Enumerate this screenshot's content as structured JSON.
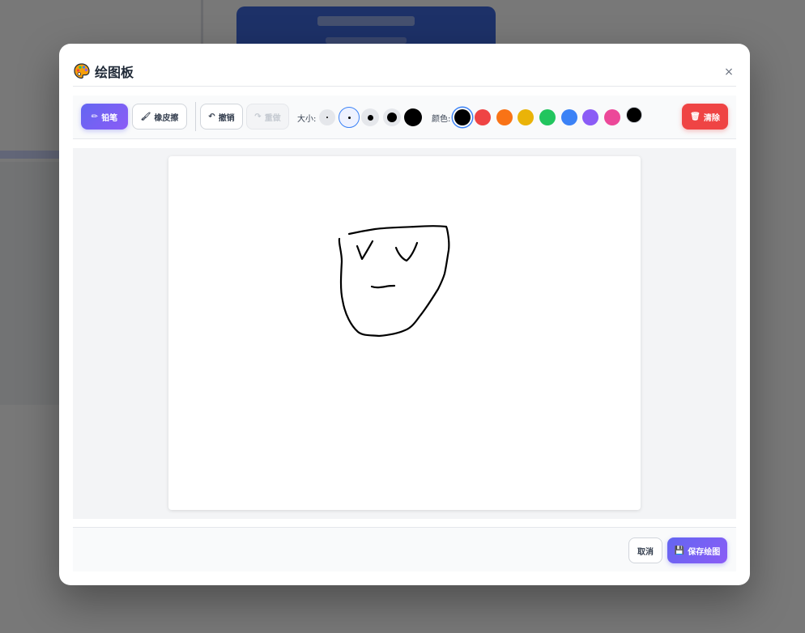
{
  "modal": {
    "title": "绘图板",
    "title_icon": "palette-icon",
    "close_label": "×"
  },
  "toolbar": {
    "pencil": {
      "icon": "✏",
      "icon_name": "pencil-icon",
      "label": "铅笔",
      "active": true
    },
    "eraser": {
      "icon": "🖌",
      "icon_name": "eraser-icon",
      "label": "橡皮擦"
    },
    "undo": {
      "icon": "↶",
      "icon_name": "undo-icon",
      "label": "撤销"
    },
    "redo": {
      "icon": "↷",
      "icon_name": "redo-icon",
      "label": "重做",
      "disabled": true
    },
    "size_label": "大小:",
    "sizes": [
      {
        "value": 1,
        "selected": false
      },
      {
        "value": 2,
        "selected": true
      },
      {
        "value": 4,
        "selected": false
      },
      {
        "value": 6,
        "selected": false
      },
      {
        "value": 10,
        "selected": false
      }
    ],
    "color_label": "颜色:",
    "colors": [
      {
        "hex": "#000000",
        "selected": true
      },
      {
        "hex": "#ef4444",
        "selected": false
      },
      {
        "hex": "#f97316",
        "selected": false
      },
      {
        "hex": "#eab308",
        "selected": false
      },
      {
        "hex": "#22c55e",
        "selected": false
      },
      {
        "hex": "#3b82f6",
        "selected": false
      },
      {
        "hex": "#8b5cf6",
        "selected": false
      },
      {
        "hex": "#ec4899",
        "selected": false
      }
    ],
    "custom_color": "#000000",
    "clear": {
      "icon": "🗑",
      "icon_name": "trash-icon",
      "label": "清除"
    }
  },
  "canvas": {
    "stroke_color": "#000000"
  },
  "footer": {
    "cancel_label": "取消",
    "save": {
      "icon": "💾",
      "icon_name": "save-icon",
      "label": "保存绘图"
    }
  },
  "colors": {
    "accent": "#6366f1",
    "accent_2": "#8b5cf6",
    "danger": "#ef4444",
    "selection": "#3b82f6"
  }
}
